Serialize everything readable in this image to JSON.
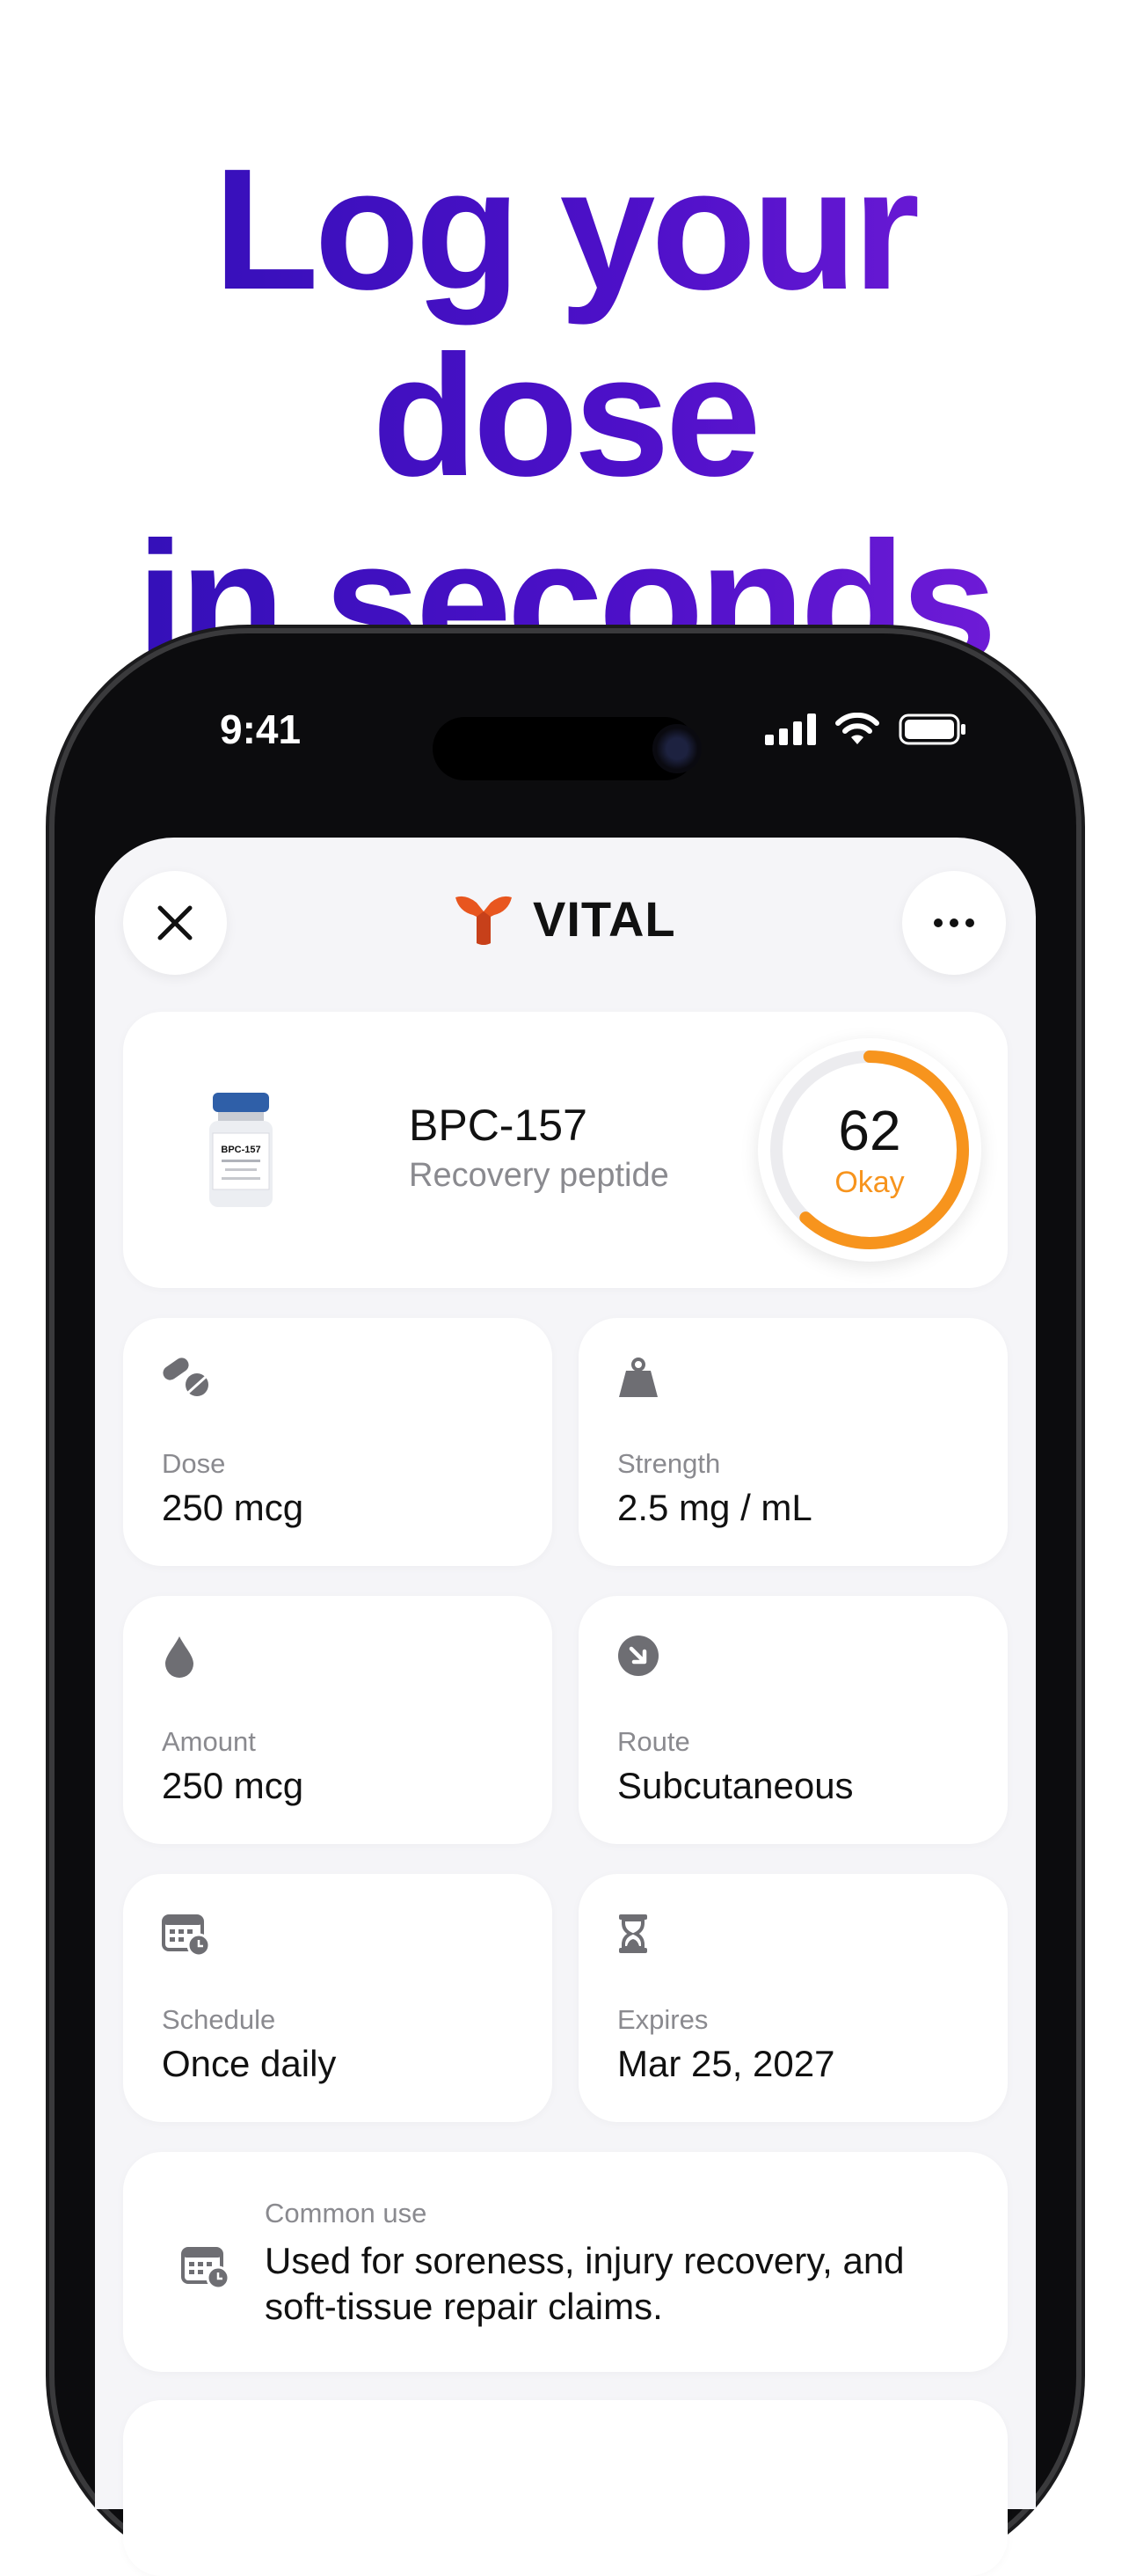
{
  "headline": {
    "line1": "Log your dose",
    "line2": "in seconds"
  },
  "status_bar": {
    "time": "9:41",
    "icons": [
      "cellular-signal-icon",
      "wifi-icon",
      "battery-icon"
    ]
  },
  "app": {
    "title": "VITAL",
    "close_icon": "close-icon",
    "more_icon": "more-icon",
    "brand_color": "#e8561f"
  },
  "peptide": {
    "name": "BPC-157",
    "subtitle": "Recovery peptide",
    "vial_label": "BPC-157",
    "score": {
      "value": "62",
      "label": "Okay",
      "fraction": 0.62,
      "color": "#f7941d"
    }
  },
  "tiles": [
    {
      "label": "Dose",
      "value": "250 mcg",
      "icon": "pills-icon"
    },
    {
      "label": "Strength",
      "value": "2.5 mg / mL",
      "icon": "weight-icon"
    },
    {
      "label": "Amount",
      "value": "250 mcg",
      "icon": "drop-icon"
    },
    {
      "label": "Route",
      "value": "Subcutaneous",
      "icon": "arrow-down-right-circle-icon"
    },
    {
      "label": "Schedule",
      "value": "Once daily",
      "icon": "calendar-clock-icon"
    },
    {
      "label": "Expires",
      "value": "Mar 25, 2027",
      "icon": "hourglass-icon"
    }
  ],
  "common_use": {
    "label": "Common use",
    "text": "Used for soreness, injury recovery, and soft-tissue repair claims.",
    "icon": "calendar-clock-icon"
  },
  "colors": {
    "headline_start": "#2d10b4",
    "headline_end": "#7a1fdc",
    "screen_bg": "#f5f5f8"
  }
}
